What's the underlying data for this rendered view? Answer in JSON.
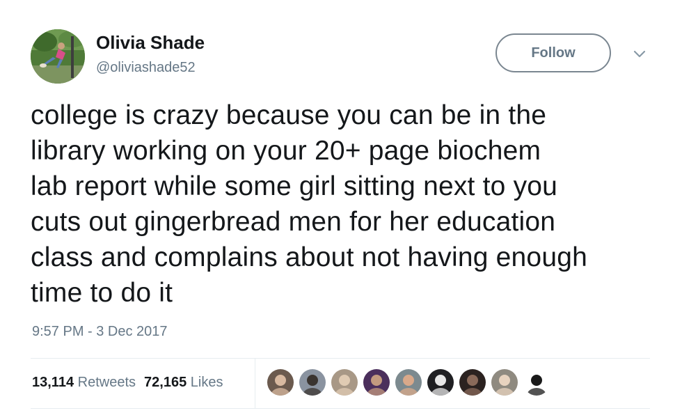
{
  "user": {
    "name": "Olivia Shade",
    "handle": "@oliviashade52"
  },
  "follow_button": {
    "label": "Follow"
  },
  "tweet": {
    "lines": [
      "college is crazy because you can be in the",
      "library working on your 20+ page biochem",
      "lab report while some girl sitting next to you",
      "cuts out gingerbread men for her education",
      "class and complains about not having enough",
      "time to do it"
    ],
    "timestamp": "9:57 PM - 3 Dec 2017"
  },
  "stats": {
    "retweets": {
      "count": "13,114",
      "label": "Retweets"
    },
    "likes": {
      "count": "72,165",
      "label": "Likes"
    }
  },
  "likers": [
    {
      "bg": "#6b5a4e",
      "fg": "#d8b9a0"
    },
    {
      "bg": "#8a93a0",
      "fg": "#3a3430"
    },
    {
      "bg": "#a89886",
      "fg": "#e0cbb3"
    },
    {
      "bg": "#4b2f5c",
      "fg": "#c39a7f"
    },
    {
      "bg": "#7c8a8f",
      "fg": "#d9a98a"
    },
    {
      "bg": "#1f1f22",
      "fg": "#e7e7e7"
    },
    {
      "bg": "#2b2220",
      "fg": "#8a6a5a"
    },
    {
      "bg": "#8f8a80",
      "fg": "#e8d3bf"
    },
    {
      "bg": "#ffffff",
      "fg": "#1a1a1a"
    }
  ],
  "colors": {
    "text": "#14171a",
    "secondary": "#657786",
    "divider": "#e6ecf0"
  }
}
